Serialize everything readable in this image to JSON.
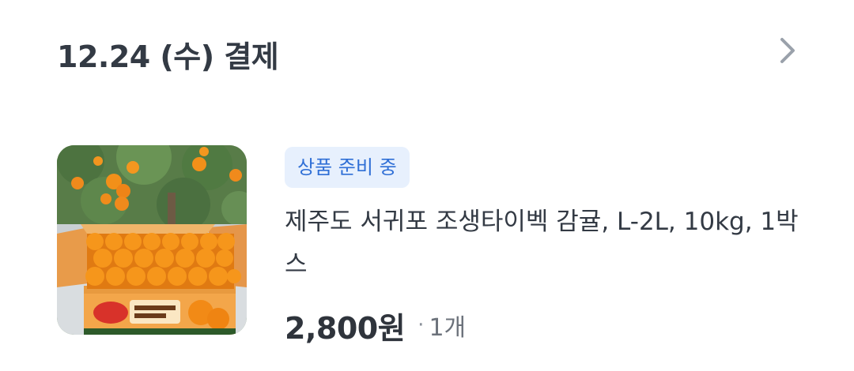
{
  "order": {
    "date_title": "12.24 (수) 결제",
    "detail_icon": "chevron-right-icon"
  },
  "product": {
    "image_desc_icon": "product-thumbnail",
    "status_badge": "상품 준비 중",
    "name": "제주도 서귀포 조생타이벡 감귤, L-2L, 10kg, 1박스",
    "price": "2,800원",
    "separator": "·",
    "quantity": "1개"
  },
  "colors": {
    "badge_bg": "#e7f0fd",
    "badge_text": "#2f6fd6",
    "text_primary": "#333a44",
    "text_secondary": "#6c727b",
    "chevron": "#9aa1ab"
  }
}
